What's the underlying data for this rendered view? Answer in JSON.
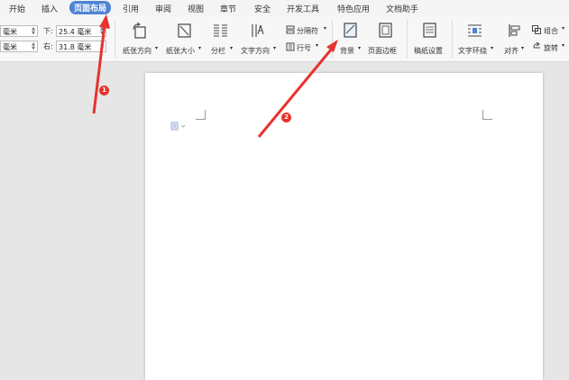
{
  "menu": {
    "tabs": [
      "开始",
      "插入",
      "页面布局",
      "引用",
      "审阅",
      "视图",
      "章节",
      "安全",
      "开发工具",
      "特色应用",
      "文档助手"
    ],
    "active_tab": "页面布局"
  },
  "margins": {
    "top_value": "毫米",
    "left_value": "毫米",
    "bottom_label": "下:",
    "bottom_value": "25.4 毫米",
    "right_label": "右:",
    "right_value": "31.8 毫米"
  },
  "toolbar": {
    "orientation": "纸张方向",
    "size": "纸张大小",
    "columns": "分栏",
    "text_direction": "文字方向",
    "breaks": "分隔符",
    "line_numbers": "行号",
    "background": "背景",
    "page_border": "页面边框",
    "manuscript": "稿纸设置",
    "wrap_text": "文字环绕",
    "align": "对齐",
    "group": "组合",
    "rotate": "旋转"
  },
  "annotations": {
    "badge_1": "1",
    "badge_2": "2",
    "color": "#e8322e"
  }
}
